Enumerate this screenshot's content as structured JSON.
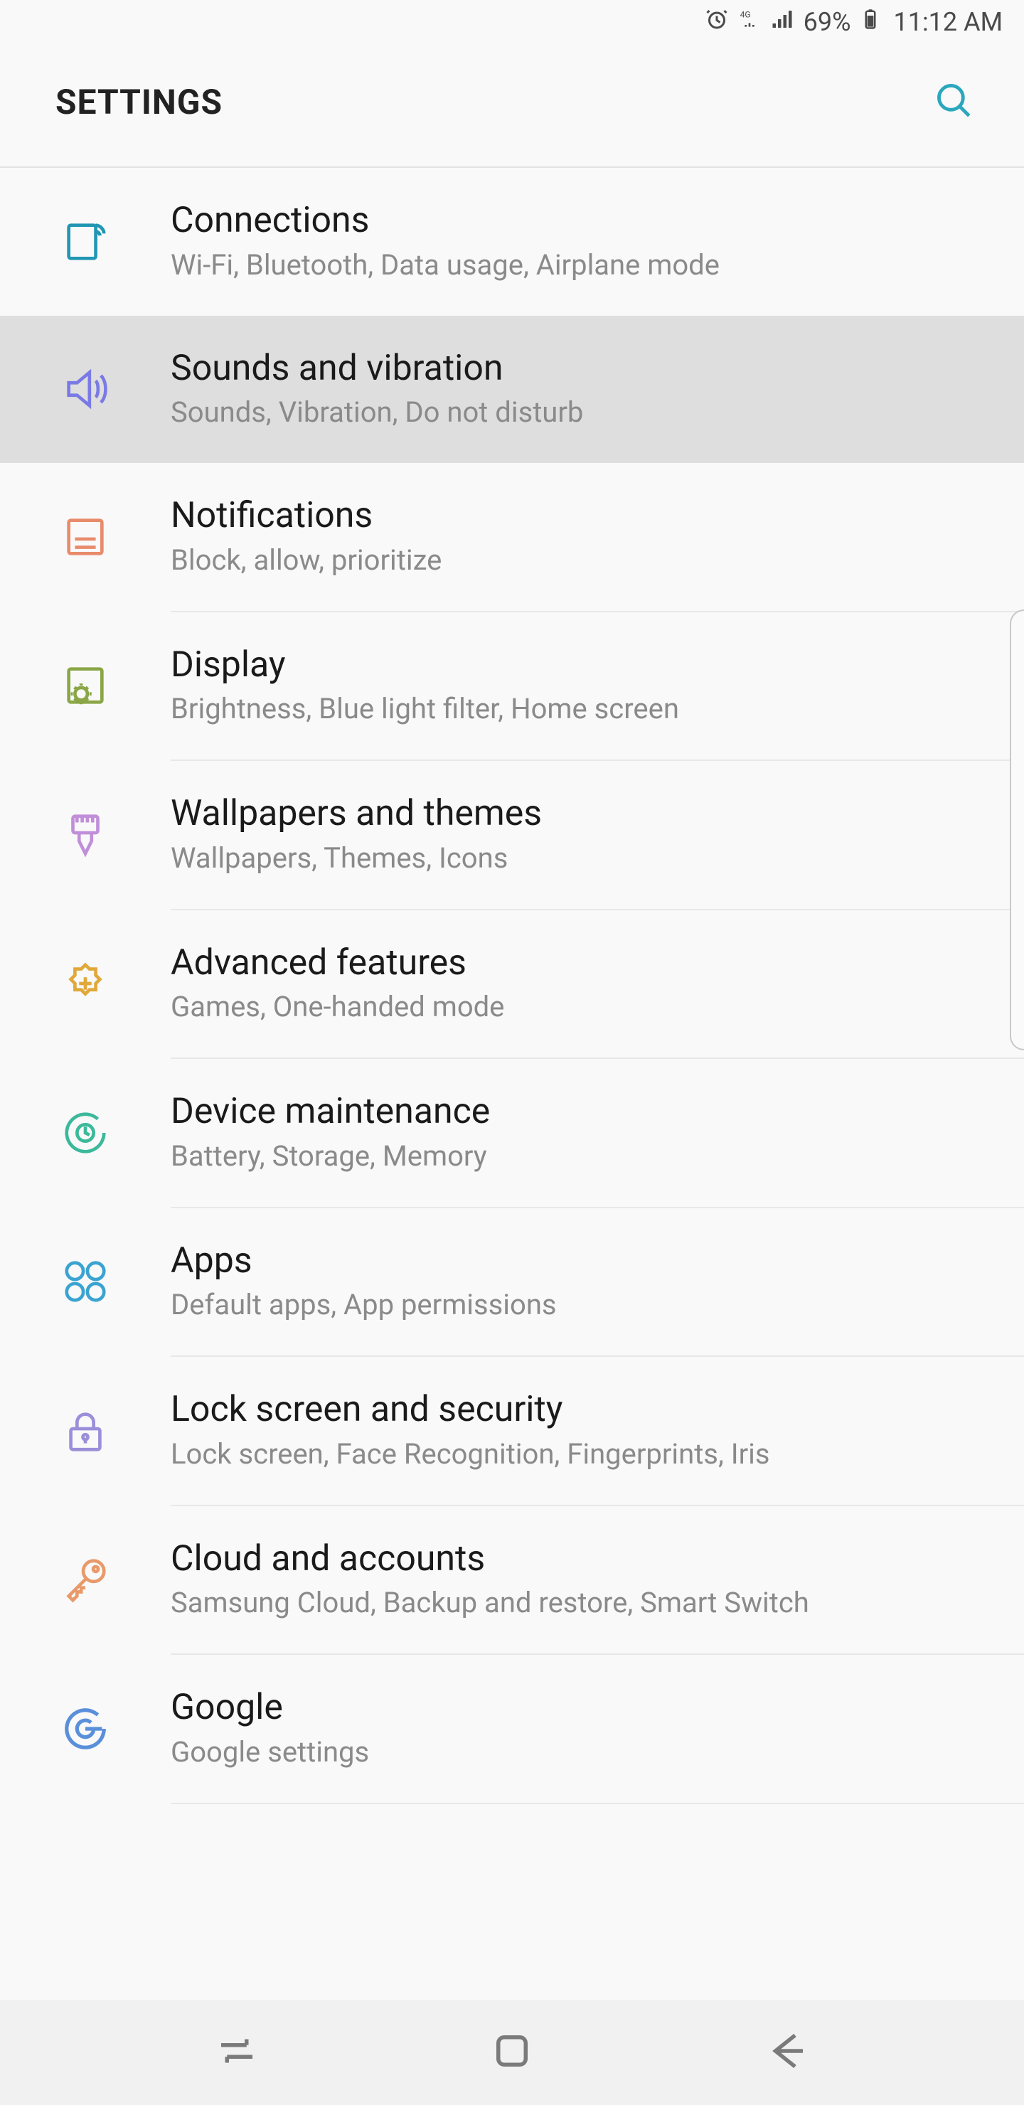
{
  "status_bar": {
    "battery_pct": "69%",
    "time": "11:12 AM"
  },
  "header": {
    "title": "SETTINGS"
  },
  "items": [
    {
      "title": "Connections",
      "subtitle": "Wi-Fi, Bluetooth, Data usage, Airplane mode"
    },
    {
      "title": "Sounds and vibration",
      "subtitle": "Sounds, Vibration, Do not disturb"
    },
    {
      "title": "Notifications",
      "subtitle": "Block, allow, prioritize"
    },
    {
      "title": "Display",
      "subtitle": "Brightness, Blue light filter, Home screen"
    },
    {
      "title": "Wallpapers and themes",
      "subtitle": "Wallpapers, Themes, Icons"
    },
    {
      "title": "Advanced features",
      "subtitle": "Games, One-handed mode"
    },
    {
      "title": "Device maintenance",
      "subtitle": "Battery, Storage, Memory"
    },
    {
      "title": "Apps",
      "subtitle": "Default apps, App permissions"
    },
    {
      "title": "Lock screen and security",
      "subtitle": "Lock screen, Face Recognition, Fingerprints, Iris"
    },
    {
      "title": "Cloud and accounts",
      "subtitle": "Samsung Cloud, Backup and restore, Smart Switch"
    },
    {
      "title": "Google",
      "subtitle": "Google settings"
    }
  ],
  "icon_colors": {
    "connections": "#2196b3",
    "sounds": "#7a7ae6",
    "notifications": "#e88b6a",
    "display": "#8aa646",
    "wallpapers": "#c18fd9",
    "advanced": "#e0a83a",
    "maintenance": "#3bb99a",
    "apps": "#3aa3d1",
    "lock": "#9a8fd9",
    "cloud": "#e89a6a",
    "google": "#5a8fd9"
  }
}
